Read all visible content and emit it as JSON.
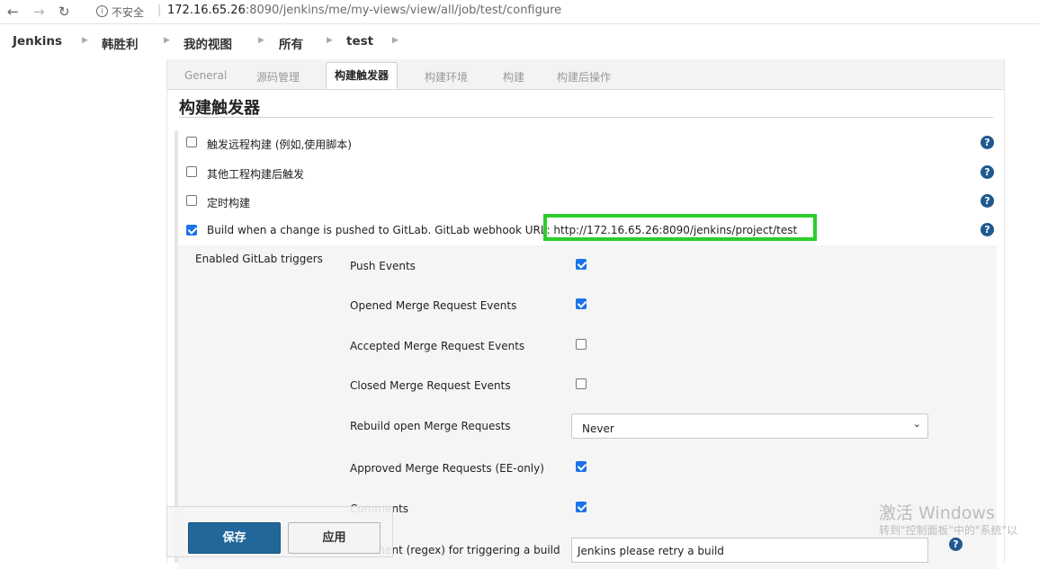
{
  "browser": {
    "security_label": "不安全",
    "url_host": "172.16.65.26",
    "url_path": ":8090/jenkins/me/my-views/view/all/job/test/configure"
  },
  "breadcrumbs": [
    "Jenkins",
    "韩胜利",
    "我的视图",
    "所有",
    "test"
  ],
  "tabs": [
    "General",
    "源码管理",
    "构建触发器",
    "构建环境",
    "构建",
    "构建后操作"
  ],
  "active_tab": "构建触发器",
  "section_title": "构建触发器",
  "triggers": [
    {
      "label": "触发远程构建 (例如,使用脚本)",
      "checked": false
    },
    {
      "label": "其他工程构建后触发",
      "checked": false
    },
    {
      "label": "定时构建",
      "checked": false
    },
    {
      "label": "Build when a change is pushed to GitLab. GitLab webhook URL: http://172.16.65.26:8090/jenkins/project/test",
      "checked": true
    }
  ],
  "gitlab": {
    "section_label": "Enabled GitLab triggers",
    "events": [
      {
        "label": "Push Events",
        "checked": true
      },
      {
        "label": "Opened Merge Request Events",
        "checked": true
      },
      {
        "label": "Accepted Merge Request Events",
        "checked": false
      },
      {
        "label": "Closed Merge Request Events",
        "checked": false
      },
      {
        "label": "Approved Merge Requests (EE-only)",
        "checked": true
      },
      {
        "label": "Comments",
        "checked": true
      }
    ],
    "rebuild_label": "Rebuild open Merge Requests",
    "rebuild_value": "Never",
    "comment_regex_label": "Comment (regex) for triggering a build",
    "comment_regex_value": "Jenkins please retry a build"
  },
  "buttons": {
    "save": "保存",
    "apply": "应用"
  },
  "watermark": {
    "line1": "激活 Windows",
    "line2": "转到\"控制面板\"中的\"系统\"以"
  },
  "colors": {
    "highlight_box": "#2dcc2d",
    "save_button": "#21679a",
    "checkbox_checked": "#1a73e8",
    "help_icon": "#20598f"
  }
}
